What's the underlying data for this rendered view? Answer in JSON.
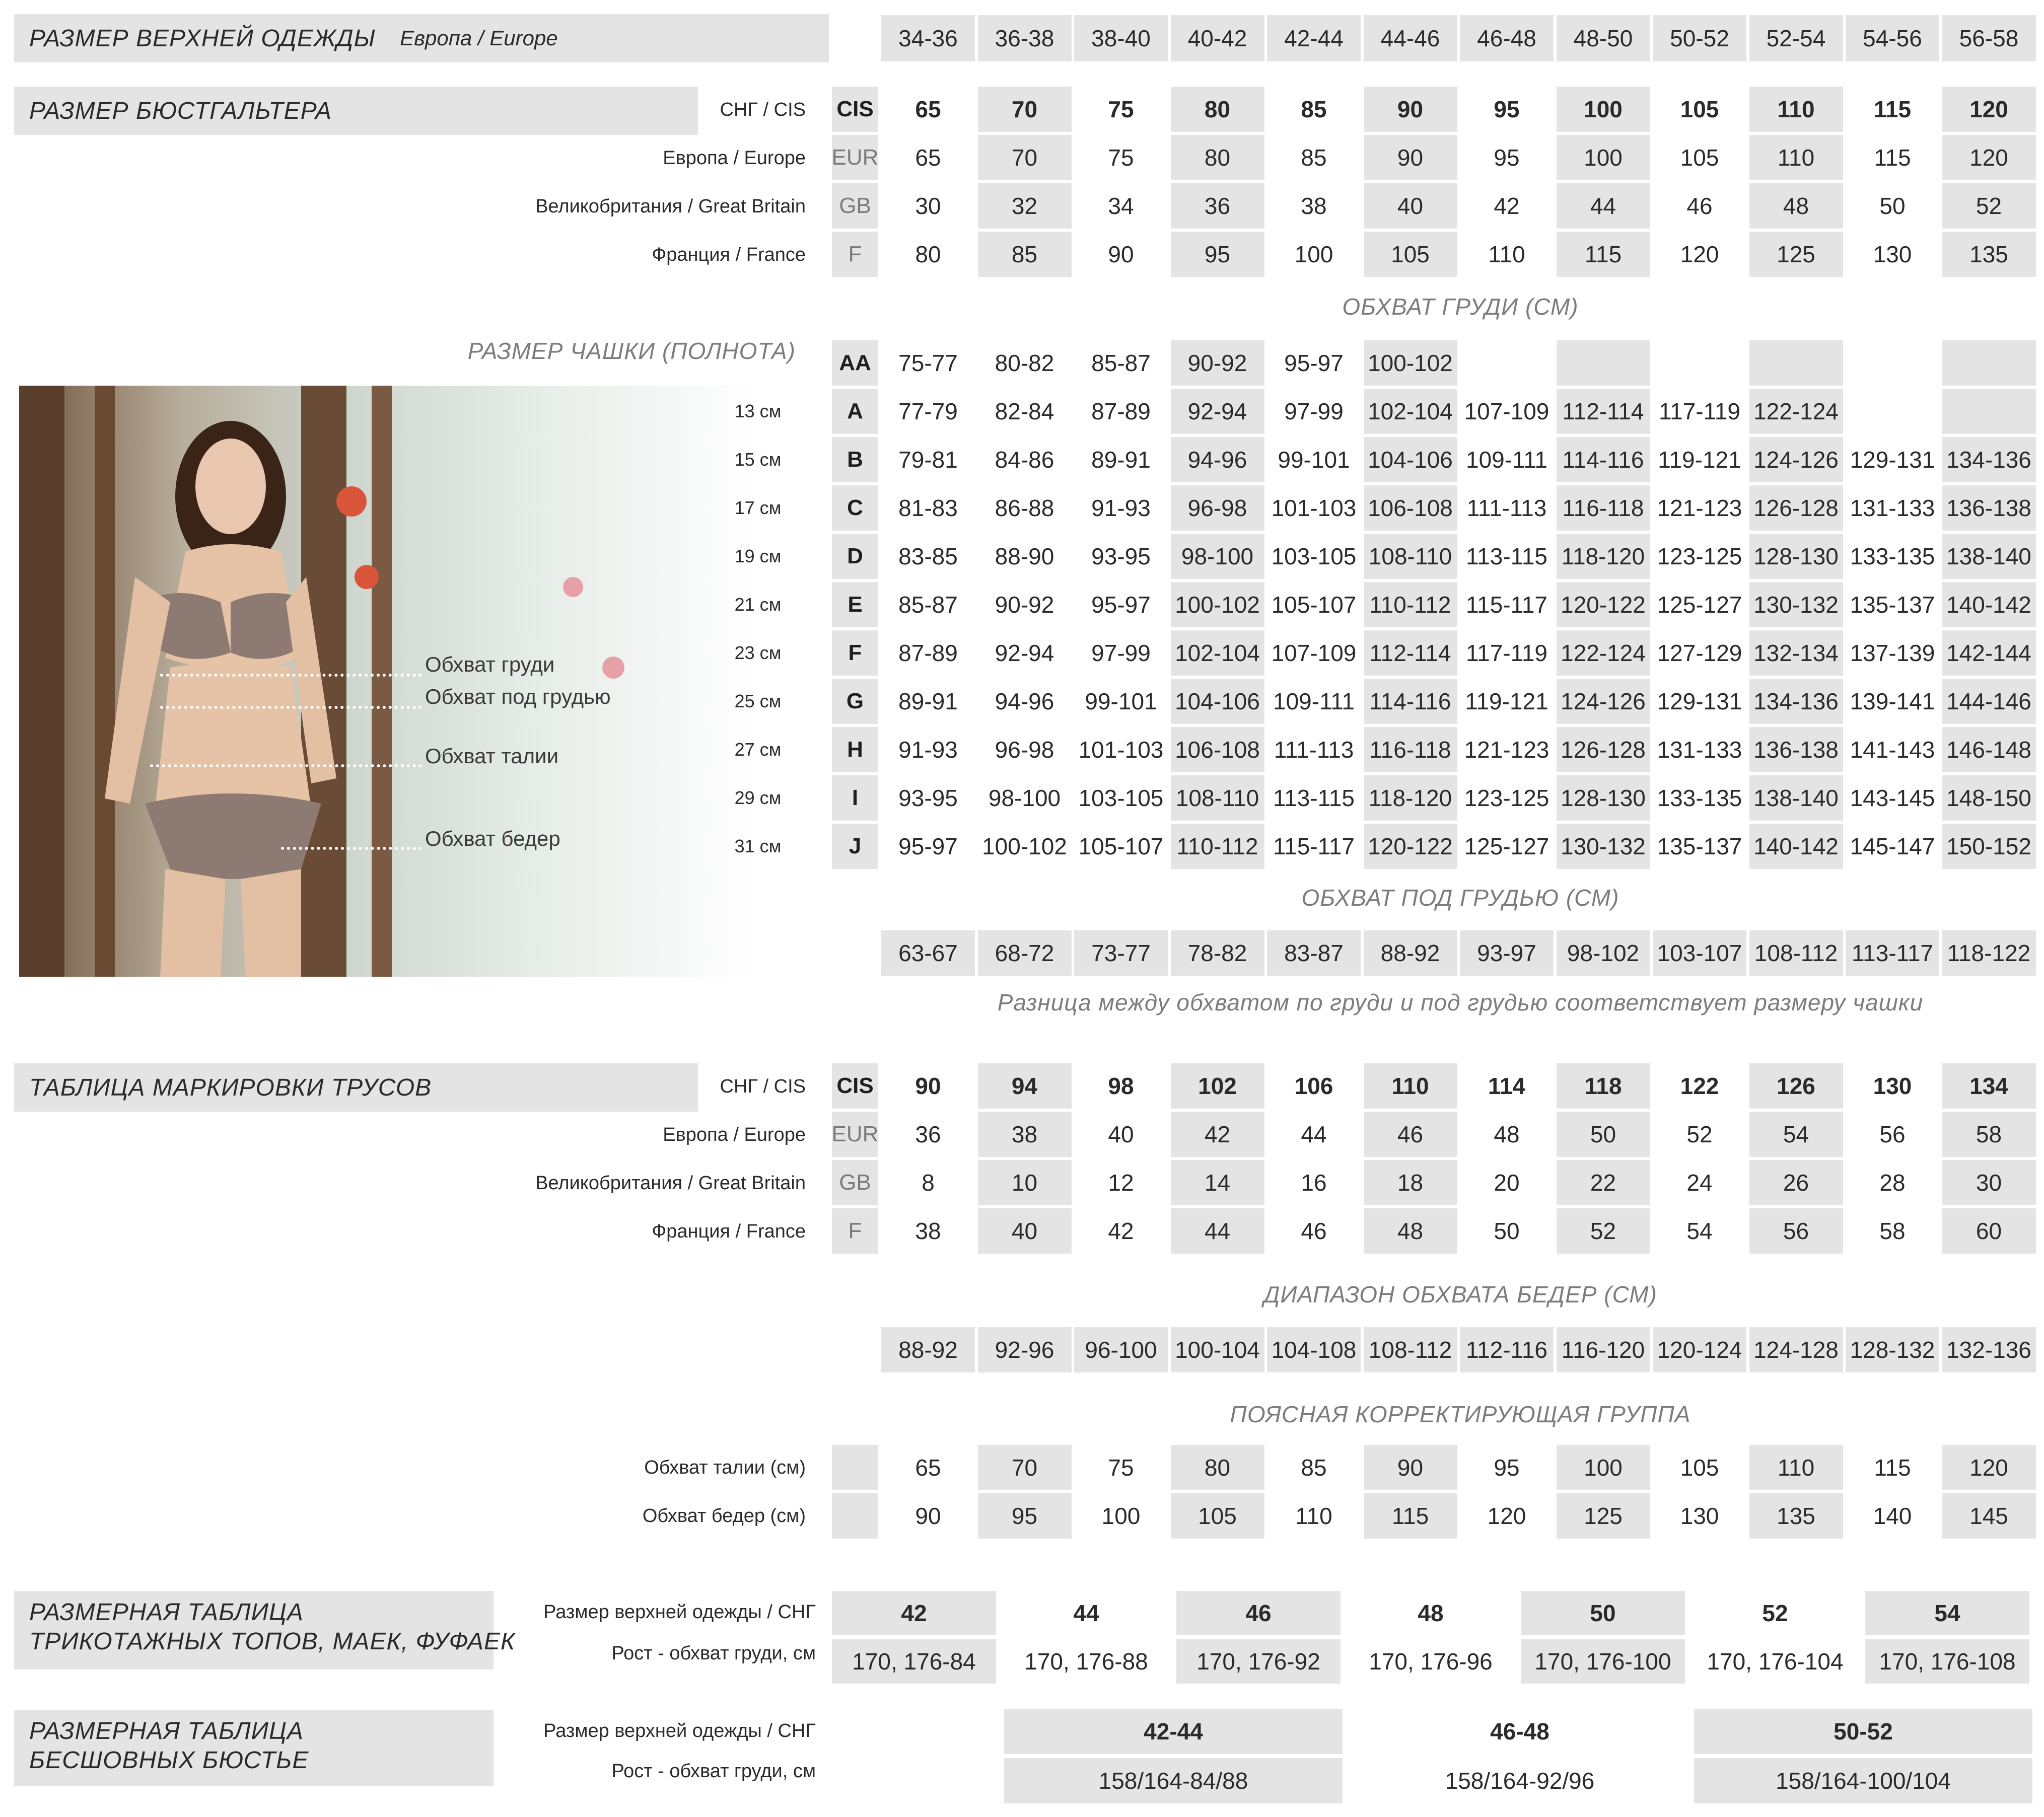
{
  "outerwear": {
    "title": "РАЗМЕР ВЕРХНЕЙ ОДЕЖДЫ",
    "subtitle": "Европа / Europe",
    "sizes": [
      "34-36",
      "36-38",
      "38-40",
      "40-42",
      "42-44",
      "44-46",
      "46-48",
      "48-50",
      "50-52",
      "52-54",
      "54-56",
      "56-58"
    ]
  },
  "bra": {
    "title": "РАЗМЕР БЮСТГАЛЬТЕРА",
    "rows": [
      {
        "label": "СНГ / CIS",
        "key": "CIS",
        "values": [
          "65",
          "70",
          "75",
          "80",
          "85",
          "90",
          "95",
          "100",
          "105",
          "110",
          "115",
          "120"
        ]
      },
      {
        "label": "Европа / Europe",
        "key": "EUR",
        "values": [
          "65",
          "70",
          "75",
          "80",
          "85",
          "90",
          "95",
          "100",
          "105",
          "110",
          "115",
          "120"
        ]
      },
      {
        "label": "Великобритания / Great Britain",
        "key": "GB",
        "values": [
          "30",
          "32",
          "34",
          "36",
          "38",
          "40",
          "42",
          "44",
          "46",
          "48",
          "50",
          "52"
        ]
      },
      {
        "label": "Франция / France",
        "key": "F",
        "values": [
          "80",
          "85",
          "90",
          "95",
          "100",
          "105",
          "110",
          "115",
          "120",
          "125",
          "130",
          "135"
        ]
      }
    ]
  },
  "chest_caption": "ОБХВАТ ГРУДИ (СМ)",
  "cup_caption": "РАЗМЕР ЧАШКИ (ПОЛНОТА)",
  "cups": [
    {
      "cm": "",
      "key": "AA",
      "values": [
        "75-77",
        "80-82",
        "85-87",
        "90-92",
        "95-97",
        "100-102",
        "",
        "",
        "",
        "",
        "",
        ""
      ]
    },
    {
      "cm": "13 см",
      "key": "A",
      "values": [
        "77-79",
        "82-84",
        "87-89",
        "92-94",
        "97-99",
        "102-104",
        "107-109",
        "112-114",
        "117-119",
        "122-124",
        "",
        ""
      ]
    },
    {
      "cm": "15 см",
      "key": "B",
      "values": [
        "79-81",
        "84-86",
        "89-91",
        "94-96",
        "99-101",
        "104-106",
        "109-111",
        "114-116",
        "119-121",
        "124-126",
        "129-131",
        "134-136"
      ]
    },
    {
      "cm": "17 см",
      "key": "C",
      "values": [
        "81-83",
        "86-88",
        "91-93",
        "96-98",
        "101-103",
        "106-108",
        "111-113",
        "116-118",
        "121-123",
        "126-128",
        "131-133",
        "136-138"
      ]
    },
    {
      "cm": "19 см",
      "key": "D",
      "values": [
        "83-85",
        "88-90",
        "93-95",
        "98-100",
        "103-105",
        "108-110",
        "113-115",
        "118-120",
        "123-125",
        "128-130",
        "133-135",
        "138-140"
      ]
    },
    {
      "cm": "21 см",
      "key": "E",
      "values": [
        "85-87",
        "90-92",
        "95-97",
        "100-102",
        "105-107",
        "110-112",
        "115-117",
        "120-122",
        "125-127",
        "130-132",
        "135-137",
        "140-142"
      ]
    },
    {
      "cm": "23 см",
      "key": "F",
      "values": [
        "87-89",
        "92-94",
        "97-99",
        "102-104",
        "107-109",
        "112-114",
        "117-119",
        "122-124",
        "127-129",
        "132-134",
        "137-139",
        "142-144"
      ]
    },
    {
      "cm": "25 см",
      "key": "G",
      "values": [
        "89-91",
        "94-96",
        "99-101",
        "104-106",
        "109-111",
        "114-116",
        "119-121",
        "124-126",
        "129-131",
        "134-136",
        "139-141",
        "144-146"
      ]
    },
    {
      "cm": "27 см",
      "key": "H",
      "values": [
        "91-93",
        "96-98",
        "101-103",
        "106-108",
        "111-113",
        "116-118",
        "121-123",
        "126-128",
        "131-133",
        "136-138",
        "141-143",
        "146-148"
      ]
    },
    {
      "cm": "29 см",
      "key": "I",
      "values": [
        "93-95",
        "98-100",
        "103-105",
        "108-110",
        "113-115",
        "118-120",
        "123-125",
        "128-130",
        "133-135",
        "138-140",
        "143-145",
        "148-150"
      ]
    },
    {
      "cm": "31 см",
      "key": "J",
      "values": [
        "95-97",
        "100-102",
        "105-107",
        "110-112",
        "115-117",
        "120-122",
        "125-127",
        "130-132",
        "135-137",
        "140-142",
        "145-147",
        "150-152"
      ]
    }
  ],
  "measurements": [
    "Обхват груди",
    "Обхват под грудью",
    "Обхват талии",
    "Обхват бедер"
  ],
  "underbust_caption": "ОБХВАТ ПОД ГРУДЬЮ (СМ)",
  "underbust": [
    "63-67",
    "68-72",
    "73-77",
    "78-82",
    "83-87",
    "88-92",
    "93-97",
    "98-102",
    "103-107",
    "108-112",
    "113-117",
    "118-122"
  ],
  "cup_note": "Разница между обхватом по груди и под грудью соответствует размеру чашки",
  "briefs": {
    "title": "ТАБЛИЦА  МАРКИРОВКИ ТРУСОВ",
    "rows": [
      {
        "label": "СНГ / CIS",
        "key": "CIS",
        "values": [
          "90",
          "94",
          "98",
          "102",
          "106",
          "110",
          "114",
          "118",
          "122",
          "126",
          "130",
          "134"
        ]
      },
      {
        "label": "Европа / Europe",
        "key": "EUR",
        "values": [
          "36",
          "38",
          "40",
          "42",
          "44",
          "46",
          "48",
          "50",
          "52",
          "54",
          "56",
          "58"
        ]
      },
      {
        "label": "Великобритания / Great Britain",
        "key": "GB",
        "values": [
          "8",
          "10",
          "12",
          "14",
          "16",
          "18",
          "20",
          "22",
          "24",
          "26",
          "28",
          "30"
        ]
      },
      {
        "label": "Франция / France",
        "key": "F",
        "values": [
          "38",
          "40",
          "42",
          "44",
          "46",
          "48",
          "50",
          "52",
          "54",
          "56",
          "58",
          "60"
        ]
      }
    ]
  },
  "hips_caption": "ДИАПАЗОН ОБХВАТА БЕДЕР (СМ)",
  "hips": [
    "88-92",
    "92-96",
    "96-100",
    "100-104",
    "104-108",
    "108-112",
    "112-116",
    "116-120",
    "120-124",
    "124-128",
    "128-132",
    "132-136"
  ],
  "waist_group": {
    "caption": "ПОЯСНАЯ КОРРЕКТИРУЮЩАЯ ГРУППА",
    "rows": [
      {
        "label": "Обхват талии (см)",
        "values": [
          "65",
          "70",
          "75",
          "80",
          "85",
          "90",
          "95",
          "100",
          "105",
          "110",
          "115",
          "120"
        ]
      },
      {
        "label": "Обхват бедер (см)",
        "values": [
          "90",
          "95",
          "100",
          "105",
          "110",
          "115",
          "120",
          "125",
          "130",
          "135",
          "140",
          "145"
        ]
      }
    ]
  },
  "tops": {
    "title_line1": "РАЗМЕРНАЯ  ТАБЛИЦА",
    "title_line2": "ТРИКОТАЖНЫХ ТОПОВ, МАЕК, ФУФАЕК",
    "row1_label": "Размер верхней одежды / СНГ",
    "row2_label": "Рост -  обхват груди, см",
    "sizes": [
      "42",
      "44",
      "46",
      "48",
      "50",
      "52",
      "54"
    ],
    "heights": [
      "170, 176-84",
      "170, 176-88",
      "170, 176-92",
      "170, 176-96",
      "170, 176-100",
      "170, 176-104",
      "170, 176-108"
    ]
  },
  "bustier": {
    "title_line1": "РАЗМЕРНАЯ  ТАБЛИЦА",
    "title_line2": "БЕСШОВНЫХ  БЮСТЬЕ",
    "row1_label": "Размер верхней одежды / СНГ",
    "row2_label": "Рост -  обхват груди, см",
    "sizes": [
      "42-44",
      "46-48",
      "50-52"
    ],
    "heights": [
      "158/164-84/88",
      "158/164-92/96",
      "158/164-100/104"
    ]
  }
}
